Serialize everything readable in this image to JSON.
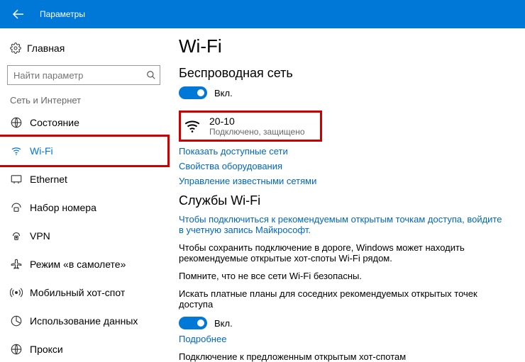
{
  "titlebar": {
    "label": "Параметры"
  },
  "sidebar": {
    "home_label": "Главная",
    "search_placeholder": "Найти параметр",
    "group_label": "Сеть и Интернет",
    "items": [
      {
        "label": "Состояние"
      },
      {
        "label": "Wi-Fi"
      },
      {
        "label": "Ethernet"
      },
      {
        "label": "Набор номера"
      },
      {
        "label": "VPN"
      },
      {
        "label": "Режим «в самолете»"
      },
      {
        "label": "Мобильный хот-спот"
      },
      {
        "label": "Использование данных"
      },
      {
        "label": "Прокси"
      }
    ]
  },
  "main": {
    "title": "Wi-Fi",
    "wireless_heading": "Беспроводная сеть",
    "wireless_toggle_label": "Вкл.",
    "connection": {
      "ssid": "20-10",
      "status": "Подключено, защищено"
    },
    "links": {
      "show_available": "Показать доступные сети",
      "hardware_props": "Свойства оборудования",
      "manage_known": "Управление известными сетями",
      "more": "Подробнее"
    },
    "services_heading": "Службы Wi-Fi",
    "services_signin": "Чтобы подключиться к рекомендуемым открытым точкам доступа, войдите в учетную запись Майкрософт.",
    "services_p1": "Чтобы сохранить подключение в дороге, Windows может находить рекомендуемые открытые хот-споты Wi-Fi рядом.",
    "services_p2": "Помните, что не все сети Wi-Fi безопасны.",
    "services_p3": "Искать платные планы для соседних рекомендуемых открытых точек доступа",
    "services_toggle_label": "Вкл.",
    "services_p4": "Подключение к предложенным открытым хот-спотам"
  }
}
